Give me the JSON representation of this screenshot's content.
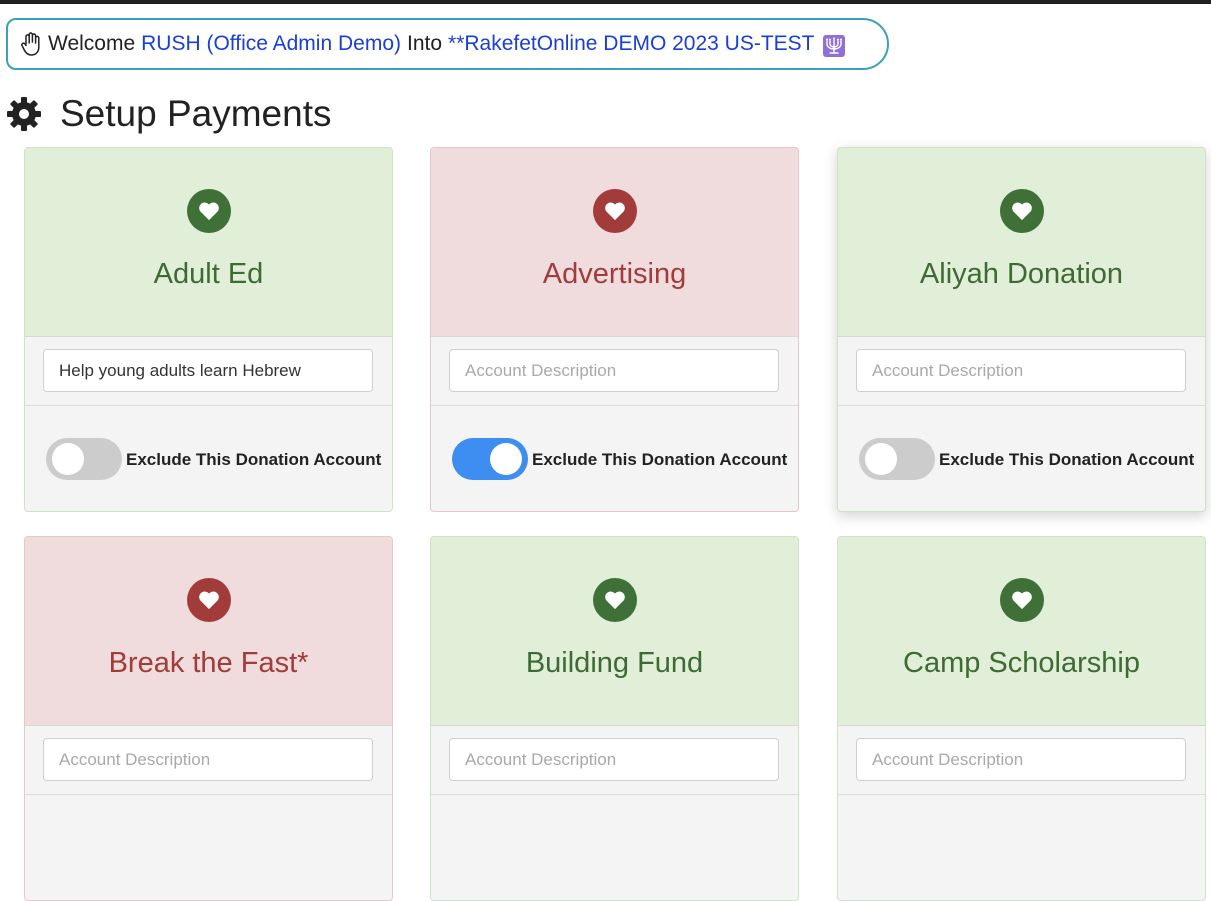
{
  "welcome": {
    "prefix": "Welcome",
    "user": "RUSH (Office Admin Demo)",
    "into": "Into",
    "org": "**RakefetOnline DEMO 2023 US-TEST"
  },
  "page": {
    "title": "Setup Payments"
  },
  "colors": {
    "green": "#3f7038",
    "red": "#a23c3a",
    "toggle_on": "#3d8ef0",
    "link": "#1a3fd6"
  },
  "accounts": [
    {
      "name": "Adult Ed",
      "status": "green",
      "description_value": "Help young adults learn Hebrew",
      "description_placeholder": "Account Description",
      "exclude_label": "Exclude This Donation Account",
      "excluded": false
    },
    {
      "name": "Advertising",
      "status": "red",
      "description_value": "",
      "description_placeholder": "Account Description",
      "exclude_label": "Exclude This Donation Account",
      "excluded": true
    },
    {
      "name": "Aliyah Donation",
      "status": "green",
      "description_value": "",
      "description_placeholder": "Account Description",
      "exclude_label": "Exclude This Donation Account",
      "excluded": false
    },
    {
      "name": "Break the Fast*",
      "status": "red",
      "description_value": "",
      "description_placeholder": "Account Description",
      "exclude_label": "",
      "excluded": null
    },
    {
      "name": "Building Fund",
      "status": "green",
      "description_value": "",
      "description_placeholder": "Account Description",
      "exclude_label": "",
      "excluded": null
    },
    {
      "name": "Camp Scholarship",
      "status": "green",
      "description_value": "",
      "description_placeholder": "Account Description",
      "exclude_label": "",
      "excluded": null
    }
  ]
}
